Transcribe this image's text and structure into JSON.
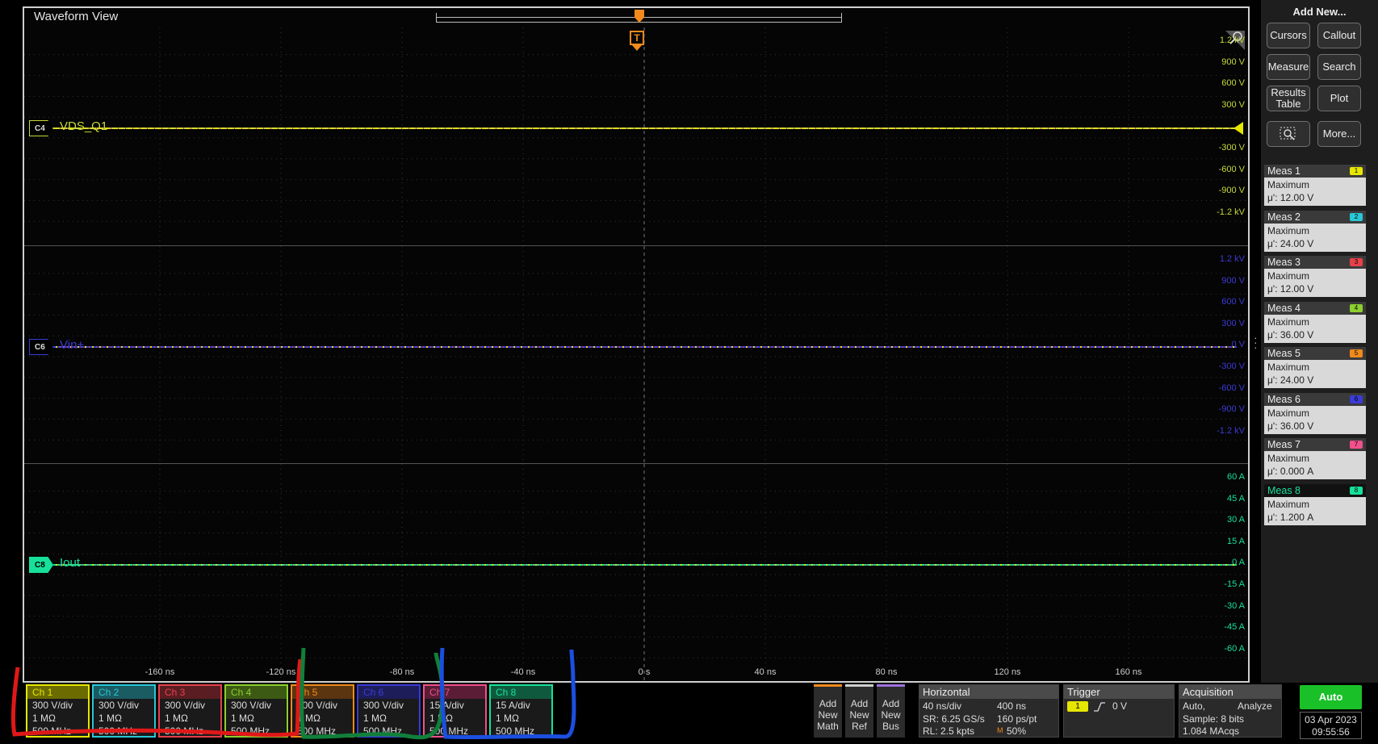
{
  "waveform_view": {
    "title": "Waveform View",
    "trigger_marker": "T",
    "panes": [
      {
        "channel_badge": "C4",
        "channel_name": "VDS_Q1",
        "color": "#c8d93a",
        "y_ticks": [
          "1.2 kV",
          "900 V",
          "600 V",
          "300 V",
          "",
          "-300 V",
          "-600 V",
          "-900 V",
          "-1.2 kV"
        ]
      },
      {
        "channel_badge": "C6",
        "channel_name": "Vin+",
        "color": "#3b3bd6",
        "y_ticks": [
          "1.2 kV",
          "900 V",
          "600 V",
          "300 V",
          "0 V",
          "-300 V",
          "-600 V",
          "-900 V",
          "-1.2 kV"
        ]
      },
      {
        "channel_badge": "C8",
        "channel_name": "Iout",
        "color": "#17e09a",
        "y_ticks": [
          "60 A",
          "45 A",
          "30 A",
          "15 A",
          "0 A",
          "-15 A",
          "-30 A",
          "-45 A",
          "-60 A"
        ]
      }
    ],
    "x_ticks": [
      "-160 ns",
      "-120 ns",
      "-80 ns",
      "-40 ns",
      "0 s",
      "40 ns",
      "80 ns",
      "120 ns",
      "160 ns"
    ]
  },
  "channels": [
    {
      "name": "Ch 1",
      "scale": "300 V/div",
      "impedance": "1 MΩ",
      "bandwidth": "500 MHz",
      "color": "#e6e600",
      "header_bg": "#6b6b00"
    },
    {
      "name": "Ch 2",
      "scale": "300 V/div",
      "impedance": "1 MΩ",
      "bandwidth": "500 MHz",
      "color": "#29c7d6",
      "header_bg": "#1b5b62"
    },
    {
      "name": "Ch 3",
      "scale": "300 V/div",
      "impedance": "1 MΩ",
      "bandwidth": "500 MHz",
      "color": "#e6404a",
      "header_bg": "#5a1d22"
    },
    {
      "name": "Ch 4",
      "scale": "300 V/div",
      "impedance": "1 MΩ",
      "bandwidth": "500 MHz",
      "color": "#8ccf2e",
      "header_bg": "#3c5a14"
    },
    {
      "name": "Ch 5",
      "scale": "300 V/div",
      "impedance": "1 MΩ",
      "bandwidth": "500 MHz",
      "color": "#f08a1c",
      "header_bg": "#5a3510"
    },
    {
      "name": "Ch 6",
      "scale": "300 V/div",
      "impedance": "1 MΩ",
      "bandwidth": "500 MHz",
      "color": "#3b3bd6",
      "header_bg": "#1d1d5a"
    },
    {
      "name": "Ch 7",
      "scale": "15 A/div",
      "impedance": "1 MΩ",
      "bandwidth": "500 MHz",
      "color": "#f0508c",
      "header_bg": "#5a1d35"
    },
    {
      "name": "Ch 8",
      "scale": "15 A/div",
      "impedance": "1 MΩ",
      "bandwidth": "500 MHz",
      "color": "#17e09a",
      "header_bg": "#0f5a3e"
    }
  ],
  "add_buttons": [
    {
      "label_lines": [
        "Add",
        "New",
        "Math"
      ],
      "color": "#f08a1c"
    },
    {
      "label_lines": [
        "Add",
        "New",
        "Ref"
      ],
      "color": "#cfcfcf"
    },
    {
      "label_lines": [
        "Add",
        "New",
        "Bus"
      ],
      "color": "#a070e0"
    }
  ],
  "horizontal": {
    "title": "Horizontal",
    "scale": "40 ns/div",
    "record_time": "400 ns",
    "sample_rate": "SR: 6.25 GS/s",
    "resolution": "160 ps/pt",
    "record_length": "RL: 2.5 kpts",
    "position": "50%",
    "position_marker": "M"
  },
  "trigger": {
    "title": "Trigger",
    "source": "1",
    "level": "0 V",
    "slope_icon": "rising-edge-icon"
  },
  "acquisition": {
    "title": "Acquisition",
    "mode": "Auto,",
    "analyze": "Analyze",
    "sample": "Sample: 8 bits",
    "acqs": "1.084 MAcqs"
  },
  "run_state": {
    "auto_label": "Auto",
    "date": "03 Apr 2023",
    "time": "09:55:56"
  },
  "right_panel": {
    "title": "Add New...",
    "buttons": {
      "cursors": "Cursors",
      "callout": "Callout",
      "measure": "Measure",
      "search": "Search",
      "results_table": [
        "Results",
        "Table"
      ],
      "plot": "Plot",
      "more": "More..."
    },
    "measurements": [
      {
        "name": "Meas 1",
        "type": "Maximum",
        "value": "μ': 12.00 V",
        "num": "1",
        "color": "#e6e600"
      },
      {
        "name": "Meas 2",
        "type": "Maximum",
        "value": "μ': 24.00 V",
        "num": "2",
        "color": "#29c7d6"
      },
      {
        "name": "Meas 3",
        "type": "Maximum",
        "value": "μ': 12.00 V",
        "num": "3",
        "color": "#e6404a"
      },
      {
        "name": "Meas 4",
        "type": "Maximum",
        "value": "μ': 36.00 V",
        "num": "4",
        "color": "#8ccf2e"
      },
      {
        "name": "Meas 5",
        "type": "Maximum",
        "value": "μ': 24.00 V",
        "num": "5",
        "color": "#f08a1c"
      },
      {
        "name": "Meas 6",
        "type": "Maximum",
        "value": "μ': 36.00 V",
        "num": "6",
        "color": "#3b3bd6"
      },
      {
        "name": "Meas 7",
        "type": "Maximum",
        "value": "μ': 0.000 A",
        "num": "7",
        "color": "#f0508c"
      },
      {
        "name": "Meas 8",
        "type": "Maximum",
        "value": "μ': 1.200 A",
        "num": "8",
        "color": "#17e09a"
      }
    ]
  }
}
